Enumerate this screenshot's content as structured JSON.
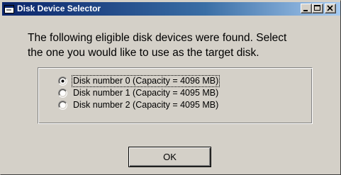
{
  "window": {
    "title": "Disk Device Selector",
    "icon": "app-window-icon",
    "controls": [
      {
        "name": "minimize",
        "icon": "minimize-icon"
      },
      {
        "name": "maximize",
        "icon": "maximize-icon"
      },
      {
        "name": "close",
        "icon": "close-icon"
      }
    ]
  },
  "intro_text": "The following eligible disk devices were found. Select\nthe one you would like to use as the target disk.",
  "disks": [
    {
      "label": "Disk number 0 (Capacity = 4096 MB)",
      "selected": true
    },
    {
      "label": "Disk number 1 (Capacity = 4095 MB)",
      "selected": false
    },
    {
      "label": "Disk number 2 (Capacity = 4095 MB)",
      "selected": false
    }
  ],
  "ok_label": "OK",
  "colors": {
    "face": "#d4d0c8",
    "title_start": "#0a246a",
    "title_end": "#a6caf0"
  }
}
